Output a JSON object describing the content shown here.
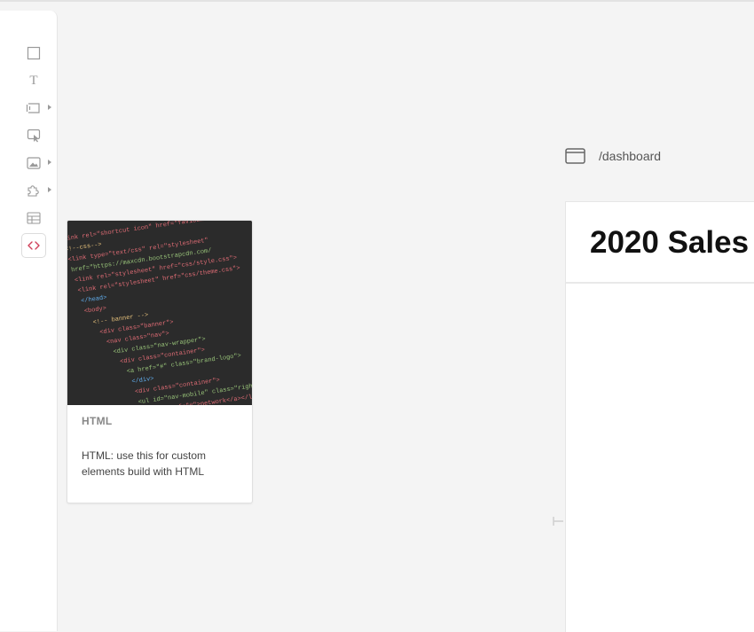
{
  "toolbar": {
    "tools": [
      {
        "id": "rectangle",
        "icon": "rectangle-icon"
      },
      {
        "id": "text",
        "icon": "text-icon",
        "glyph": "T"
      },
      {
        "id": "button",
        "icon": "button-icon",
        "has_submenu": true
      },
      {
        "id": "input",
        "icon": "click-input-icon"
      },
      {
        "id": "image",
        "icon": "image-icon",
        "has_submenu": true
      },
      {
        "id": "plugin",
        "icon": "puzzle-icon",
        "has_submenu": true
      },
      {
        "id": "table",
        "icon": "table-icon"
      },
      {
        "id": "html",
        "icon": "code-icon",
        "active": true
      }
    ],
    "active_color": "#d0405a"
  },
  "card": {
    "title": "HTML",
    "description": "HTML: use this for custom elements build with HTML",
    "image": "code-screenshot-thumbnail"
  },
  "canvas": {
    "route_icon": "browser-window-icon",
    "route_path": "/dashboard",
    "frame_title": "2020 Sales"
  }
}
